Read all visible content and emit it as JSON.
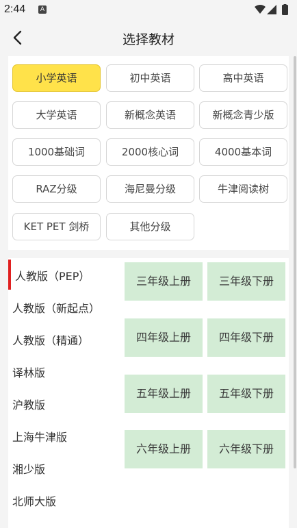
{
  "status_bar": {
    "time": "2:44",
    "notification_badge": "A"
  },
  "header": {
    "title": "选择教材",
    "back_icon": "chevron-left-icon"
  },
  "categories": [
    {
      "label": "小学英语",
      "selected": true
    },
    {
      "label": "初中英语",
      "selected": false
    },
    {
      "label": "高中英语",
      "selected": false
    },
    {
      "label": "大学英语",
      "selected": false
    },
    {
      "label": "新概念英语",
      "selected": false
    },
    {
      "label": "新概念青少版",
      "selected": false
    },
    {
      "label": "1000基础词",
      "selected": false
    },
    {
      "label": "2000核心词",
      "selected": false
    },
    {
      "label": "4000基本词",
      "selected": false
    },
    {
      "label": "RAZ分级",
      "selected": false
    },
    {
      "label": "海尼曼分级",
      "selected": false
    },
    {
      "label": "牛津阅读树",
      "selected": false
    },
    {
      "label": "KET PET 剑桥",
      "selected": false
    },
    {
      "label": "其他分级",
      "selected": false
    }
  ],
  "publishers": [
    {
      "label": "人教版（PEP）",
      "selected": true
    },
    {
      "label": "人教版（新起点）",
      "selected": false
    },
    {
      "label": "人教版（精通）",
      "selected": false
    },
    {
      "label": "译林版",
      "selected": false
    },
    {
      "label": "沪教版",
      "selected": false
    },
    {
      "label": "上海牛津版",
      "selected": false
    },
    {
      "label": "湘少版",
      "selected": false
    },
    {
      "label": "北师大版",
      "selected": false
    }
  ],
  "grades": [
    "三年级上册",
    "三年级下册",
    "四年级上册",
    "四年级下册",
    "五年级上册",
    "五年级下册",
    "六年级上册",
    "六年级下册"
  ],
  "colors": {
    "selected_category": "#ffe24a",
    "grade_tile": "#d3ecd5",
    "publisher_indicator": "#e02020"
  }
}
